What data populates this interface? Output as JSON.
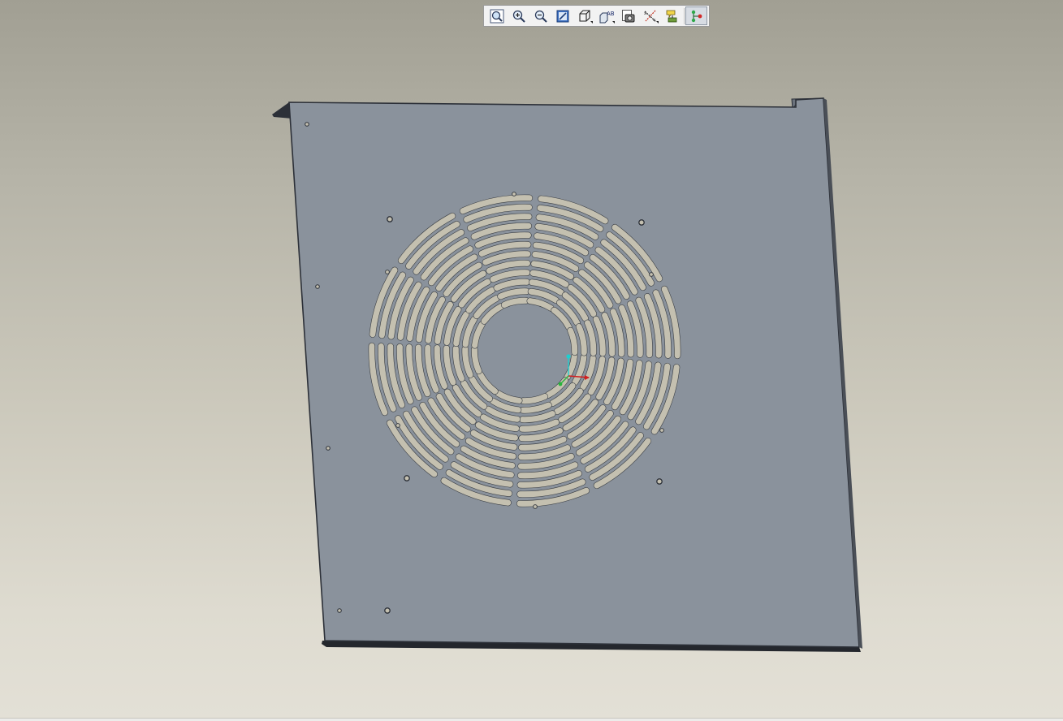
{
  "window": {
    "view": "3d-viewport"
  },
  "toolbar": {
    "buttons": [
      {
        "name": "refit-button",
        "icon": "refit-magnifier-icon"
      },
      {
        "name": "zoom-in-button",
        "icon": "zoom-in-icon"
      },
      {
        "name": "zoom-out-button",
        "icon": "zoom-out-icon"
      },
      {
        "name": "repaint-button",
        "icon": "repaint-icon"
      },
      {
        "name": "display-style-button",
        "icon": "cube-display-style-icon"
      },
      {
        "name": "saved-views-button",
        "icon": "saved-views-icon",
        "icon_text": "AB"
      },
      {
        "name": "view-manager-button",
        "icon": "view-manager-icon"
      },
      {
        "name": "datum-display-button",
        "icon": "datum-axes-icon"
      },
      {
        "name": "annotation-display-button",
        "icon": "annotation-display-icon"
      },
      {
        "name": "spin-center-button",
        "icon": "spin-center-icon",
        "active": true
      }
    ]
  },
  "colors": {
    "viewport_top": "#a19f93",
    "viewport_bottom": "#e3e0d6",
    "panel_face": "#8a929c",
    "panel_edge": "#2c3038",
    "slot_fill": "#c4c0b0",
    "slot_edge": "#3a3e44",
    "axis_x": "#d21e1e",
    "axis_y": "#1ecfcf",
    "axis_z": "#28b43c"
  },
  "model": {
    "part": "sheet-metal-panel",
    "feature": "circular-fan-grille",
    "grille_rings": 12,
    "grille_spokes": 12,
    "center_hole": true,
    "mounting_holes": 4,
    "edge_holes": 5
  }
}
